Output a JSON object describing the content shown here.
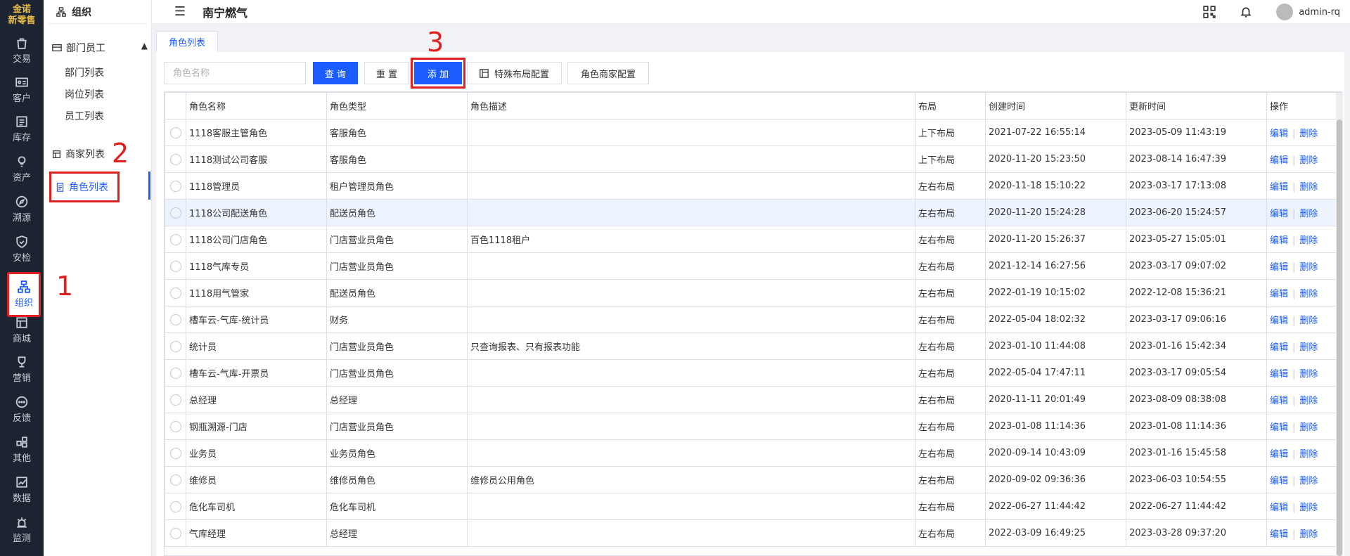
{
  "rail": {
    "logo_top": "金诺",
    "logo_bottom": "新零售",
    "items": [
      {
        "label": "交易",
        "icon": "bag-icon"
      },
      {
        "label": "客户",
        "icon": "id-card-icon"
      },
      {
        "label": "库存",
        "icon": "list-box-icon"
      },
      {
        "label": "资产",
        "icon": "bulb-icon"
      },
      {
        "label": "溯源",
        "icon": "compass-icon"
      },
      {
        "label": "安检",
        "icon": "shield-icon"
      },
      {
        "label": "组织",
        "icon": "org-icon"
      },
      {
        "label": "商城",
        "icon": "store-icon"
      },
      {
        "label": "营销",
        "icon": "trophy-icon"
      },
      {
        "label": "反馈",
        "icon": "chat-icon"
      },
      {
        "label": "其他",
        "icon": "grid-icon"
      },
      {
        "label": "数据",
        "icon": "chart-icon"
      },
      {
        "label": "监测",
        "icon": "alarm-icon"
      }
    ]
  },
  "sidebar": {
    "title": "组织",
    "group": "部门员工",
    "sub_items": [
      "部门列表",
      "岗位列表",
      "员工列表"
    ],
    "merchant_list": "商家列表",
    "role_list": "角色列表"
  },
  "header": {
    "title": "南宁燃气",
    "user": "admin-rq"
  },
  "tab": "角色列表",
  "toolbar": {
    "search_placeholder": "角色名称",
    "query": "查 询",
    "reset": "重 置",
    "add": "添 加",
    "special_layout": "特殊布局配置",
    "role_merchant": "角色商家配置"
  },
  "annotations": [
    "1",
    "2",
    "3"
  ],
  "table": {
    "headers": [
      "角色名称",
      "角色类型",
      "角色描述",
      "布局",
      "创建时间",
      "更新时间",
      "操作"
    ],
    "edit": "编辑",
    "delete": "删除",
    "rows": [
      [
        "1118客服主管角色",
        "客服角色",
        "",
        "上下布局",
        "2021-07-22 16:55:14",
        "2023-05-09 11:43:19"
      ],
      [
        "1118测试公司客服",
        "客服角色",
        "",
        "上下布局",
        "2020-11-20 15:23:50",
        "2023-08-14 16:47:39"
      ],
      [
        "1118管理员",
        "租户管理员角色",
        "",
        "左右布局",
        "2020-11-18 15:10:22",
        "2023-03-17 17:13:08"
      ],
      [
        "1118公司配送角色",
        "配送员角色",
        "",
        "左右布局",
        "2020-11-20 15:24:28",
        "2023-06-20 15:24:57"
      ],
      [
        "1118公司门店角色",
        "门店营业员角色",
        "百色1118租户",
        "左右布局",
        "2020-11-20 15:26:37",
        "2023-05-27 15:05:01"
      ],
      [
        "1118气库专员",
        "门店营业员角色",
        "",
        "左右布局",
        "2021-12-14 16:27:56",
        "2023-03-17 09:07:02"
      ],
      [
        "1118用气管家",
        "配送员角色",
        "",
        "左右布局",
        "2022-01-19 10:15:02",
        "2022-12-08 15:36:21"
      ],
      [
        "槽车云-气库-统计员",
        "财务",
        "",
        "左右布局",
        "2022-05-04 18:02:32",
        "2023-03-17 09:06:16"
      ],
      [
        "统计员",
        "门店营业员角色",
        "只查询报表、只有报表功能",
        "左右布局",
        "2023-01-10 11:44:08",
        "2023-01-16 15:42:34"
      ],
      [
        "槽车云-气库-开票员",
        "门店营业员角色",
        "",
        "左右布局",
        "2022-05-04 17:47:11",
        "2023-03-17 09:05:54"
      ],
      [
        "总经理",
        "总经理",
        "",
        "左右布局",
        "2020-11-11 20:01:49",
        "2023-08-09 08:38:08"
      ],
      [
        "钢瓶溯源-门店",
        "门店营业员角色",
        "",
        "左右布局",
        "2023-01-08 11:14:36",
        "2023-01-08 11:14:36"
      ],
      [
        "业务员",
        "业务员角色",
        "",
        "左右布局",
        "2020-09-14 10:43:09",
        "2023-01-16 15:45:58"
      ],
      [
        "维修员",
        "维修员角色",
        "维修员公用角色",
        "左右布局",
        "2020-09-02 09:36:36",
        "2023-06-03 10:54:55"
      ],
      [
        "危化车司机",
        "危化车司机",
        "",
        "左右布局",
        "2022-06-27 11:44:42",
        "2022-06-27 11:44:42"
      ],
      [
        "气库经理",
        "总经理",
        "",
        "左右布局",
        "2022-03-09 16:49:25",
        "2023-03-28 09:37:20"
      ]
    ],
    "highlight_row": 3
  }
}
